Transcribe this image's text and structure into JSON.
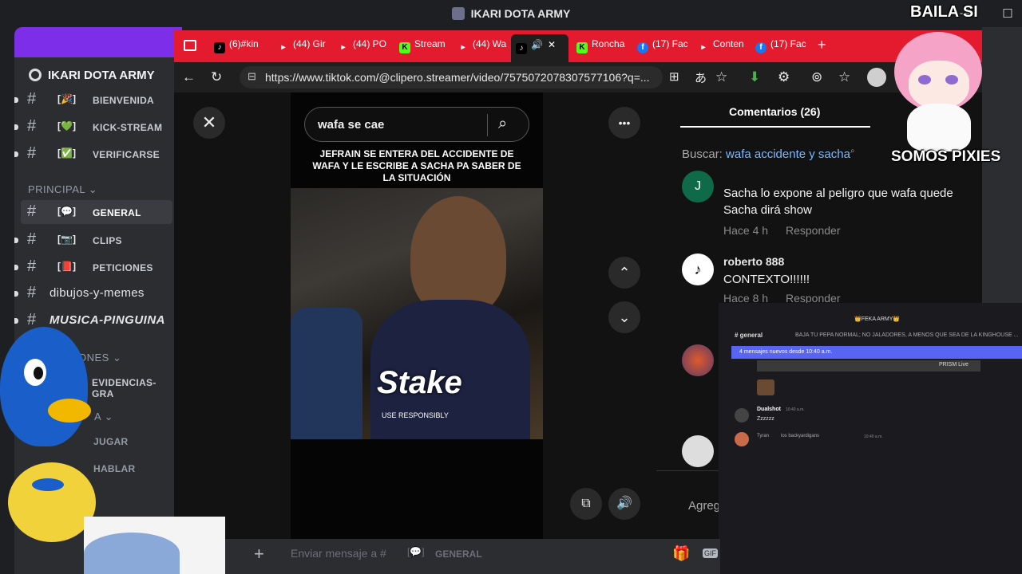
{
  "app": {
    "title": "IKARI DOTA ARMY"
  },
  "server": {
    "name": "IKARI DOTA ARMY",
    "channels_top": [
      {
        "emoji": "🎉",
        "label": "BIENVENIDA"
      },
      {
        "emoji": "💚",
        "label": "KICK-STREAM"
      },
      {
        "emoji": "✅",
        "label": "VERIFICARSE"
      }
    ],
    "category_principal": "PRINCIPAL",
    "channels_principal": [
      {
        "emoji": "💬",
        "label": "GENERAL"
      },
      {
        "emoji": "📷",
        "label": "CLIPS"
      },
      {
        "emoji": "📕",
        "label": "PETICIONES"
      }
    ],
    "channel_dibujos": "dibujos-y-memes",
    "channel_musica": "MUSICA-PINGUINA",
    "category_ones": "ONES",
    "channel_evidencias": "EVIDENCIAS-GRA",
    "category_a": "A",
    "channel_jugar": "JUGAR",
    "channel_hablar": "HABLAR"
  },
  "browser": {
    "tabs": [
      {
        "icon": "tiktok",
        "label": "(6)#kin"
      },
      {
        "icon": "youtube",
        "label": "(44) Gir"
      },
      {
        "icon": "youtube",
        "label": "(44) PO"
      },
      {
        "icon": "kick",
        "label": "Stream"
      },
      {
        "icon": "youtube",
        "label": "(44) Wa"
      },
      {
        "icon": "kick",
        "label": "Roncha"
      },
      {
        "icon": "facebook",
        "label": "(17) Fac"
      },
      {
        "icon": "youtube",
        "label": "Conten"
      },
      {
        "icon": "facebook",
        "label": "(17) Fac"
      }
    ],
    "url": "https://www.tiktok.com/@clipero.streamer/video/7575072078307577106?q=..."
  },
  "tiktok": {
    "search_query": "wafa se cae",
    "caption": "JEFRAIN SE ENTERA DEL ACCIDENTE DE WAFA Y LE ESCRIBE A SACHA PA SABER DE LA SITUACIÓN",
    "sponsor_text": "Stake",
    "sponsor_sub": "USE RESPONSIBLY",
    "comments_header": "Comentarios (26)",
    "buscar_label": "Buscar:",
    "buscar_query": "wafa accidente y sacha",
    "comments": [
      {
        "avatar": "J",
        "text": "Sacha lo expone al peligro que wafa quede Sacha dirá show",
        "time": "Hace 4 h",
        "reply": "Responder"
      },
      {
        "user": "roberto 888",
        "text": "CONTEXTO!!!!!!",
        "time": "Hace 8 h",
        "reply": "Responder"
      }
    ],
    "add_comment": "Agreg"
  },
  "overlay_chat": {
    "header": "👑FEKA ARMY👑",
    "channel": "general",
    "topic": "BAJA TU PEPA NORMAL; NO JALADORES, A MENOS QUE SEA DE LA KINGHOUSE ...",
    "new_messages": "4 mensajes nuevos desde 10:40 a.m.",
    "prism_label": "PRISM Live",
    "msg1_user": "Dualshot",
    "msg1_time": "10:40 a.m.",
    "msg1_text": "Zzzzzz",
    "msg2_user": "Tyran",
    "msg2_text": "los backyardigans",
    "msg2_time": "10:40 a.m."
  },
  "message_bar": {
    "placeholder": "Enviar mensaje a #",
    "channel": "GENERAL"
  },
  "stream_overlay": {
    "top_text": "BAILA SI",
    "bottom_text": "SOMOS PIXIES"
  }
}
